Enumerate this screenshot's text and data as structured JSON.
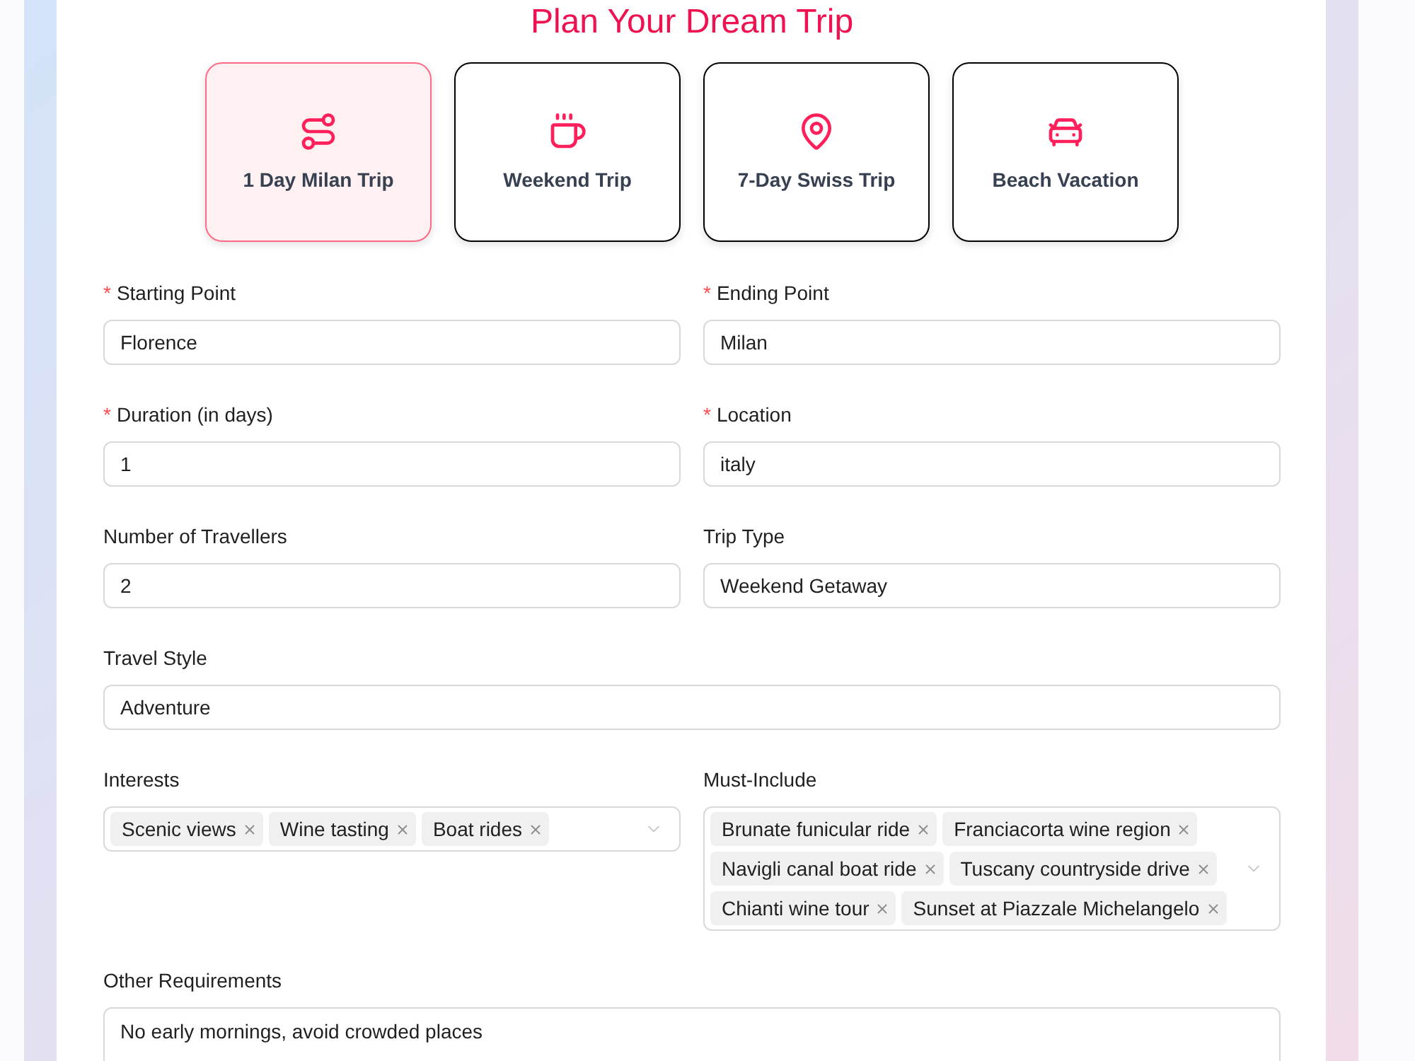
{
  "title": "Plan Your Dream Trip",
  "templates": [
    {
      "label": "1 Day Milan Trip",
      "selected": true
    },
    {
      "label": "Weekend Trip",
      "selected": false
    },
    {
      "label": "7-Day Swiss Trip",
      "selected": false
    },
    {
      "label": "Beach Vacation",
      "selected": false
    }
  ],
  "rows": [
    {
      "fields": [
        {
          "kind": "text",
          "required_mark": "*",
          "label": "Starting Point",
          "value": "Florence"
        },
        {
          "kind": "text",
          "required_mark": "*",
          "label": "Ending Point",
          "value": "Milan"
        }
      ]
    },
    {
      "fields": [
        {
          "kind": "text",
          "required_mark": "*",
          "label": "Duration (in days)",
          "value": "1"
        },
        {
          "kind": "text",
          "required_mark": "*",
          "label": "Location",
          "value": "italy"
        }
      ]
    },
    {
      "fields": [
        {
          "kind": "text",
          "label": "Number of Travellers",
          "value": "2"
        },
        {
          "kind": "text",
          "label": "Trip Type",
          "value": "Weekend Getaway"
        }
      ]
    },
    {
      "fields": [
        {
          "kind": "text",
          "label": "Travel Style",
          "value": "Adventure"
        }
      ]
    },
    {
      "fields": [
        {
          "kind": "tags",
          "label": "Interests",
          "tags": [
            "Scenic views",
            "Wine tasting",
            "Boat rides"
          ]
        },
        {
          "kind": "tags",
          "label": "Must-Include",
          "tags": [
            "Brunate funicular ride",
            "Franciacorta wine region",
            "Navigli canal boat ride",
            "Tuscany countryside drive",
            "Chianti wine tour",
            "Sunset at Piazzale Michelangelo"
          ]
        }
      ]
    },
    {
      "fields": [
        {
          "kind": "textarea",
          "label": "Other Requirements",
          "value": "No early mornings, avoid crowded places"
        }
      ]
    }
  ]
}
